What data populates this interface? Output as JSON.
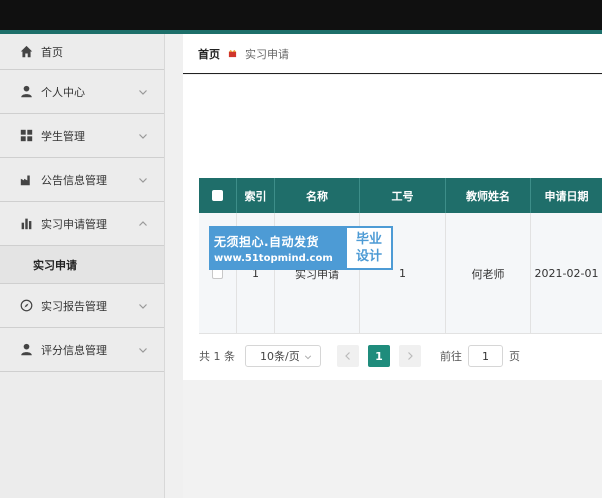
{
  "breadcrumb": {
    "home": "首页",
    "current": "实习申请"
  },
  "sidebar": {
    "items": [
      {
        "label": "首页",
        "icon": "home-icon"
      },
      {
        "label": "个人中心",
        "icon": "user-icon"
      },
      {
        "label": "学生管理",
        "icon": "grid-icon"
      },
      {
        "label": "公告信息管理",
        "icon": "factory-icon"
      },
      {
        "label": "实习申请管理",
        "icon": "bar-chart-icon"
      },
      {
        "label": "实习报告管理",
        "icon": "compass-icon"
      },
      {
        "label": "评分信息管理",
        "icon": "user-icon"
      }
    ],
    "submenu": {
      "label": "实习申请"
    }
  },
  "table": {
    "headers": [
      "",
      "索引",
      "名称",
      "工号",
      "教师姓名",
      "申请日期"
    ],
    "rows": [
      {
        "index": "1",
        "name": "实习申请",
        "job_no": "1",
        "teacher": "何老师",
        "date": "2021-02-01"
      }
    ]
  },
  "pagination": {
    "total": "共 1 条",
    "page_size": "10条/页",
    "current_page": "1",
    "goto_label": "前往",
    "goto_value": "1",
    "goto_suffix": "页"
  },
  "watermark": {
    "line1": "无须担心.自动发货",
    "line2": "www.51topmind.com",
    "badge1": "毕业",
    "badge2": "设计"
  },
  "colors": {
    "header": "#1f6e6a",
    "accent": "#1f8c7c",
    "watermark": "#4d9bd5"
  }
}
